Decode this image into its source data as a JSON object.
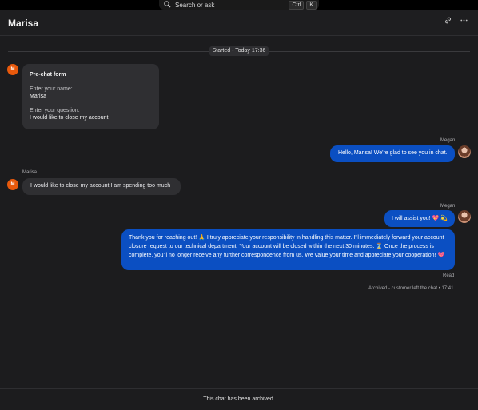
{
  "search": {
    "placeholder": "Search or ask",
    "key1": "Ctrl",
    "key2": "K"
  },
  "header": {
    "title": "Marisa",
    "icon_link": "link-icon",
    "icon_more": "more-horizontal-icon"
  },
  "started": "Started - Today 17:36",
  "visitor": {
    "initial": "M",
    "name": "Marisa"
  },
  "agent": {
    "name": "Megan"
  },
  "prechat": {
    "title": "Pre-chat form",
    "name_label": "Enter your name:",
    "name_value": "Marisa",
    "question_label": "Enter your question:",
    "question_value": "I would like to close my account"
  },
  "messages": {
    "agent_1": "Hello, Marisa! We're glad to see you in chat.",
    "visitor_1": "I would like to close my account.I am spending too much",
    "agent_2": "I will assist you!",
    "agent_2_emoji": "💖 💫",
    "agent_3_a": "Thank you for reaching out!",
    "agent_3_emoji1": "🙏",
    "agent_3_b": "I truly appreciate your responsibility in handling this matter. I'll immediately forward your account closure request to our technical department. Your account will be closed within the next 30 minutes.",
    "agent_3_emoji2": "⏳",
    "agent_3_c": "Once the process is complete, you'll no longer receive any further correspondence from us. We value your time and appreciate your cooperation!",
    "agent_3_emoji3": "💖"
  },
  "read_status": "Read",
  "archived_status": "Archived - customer left the chat • 17:41",
  "footer_text": "This chat has been archived."
}
